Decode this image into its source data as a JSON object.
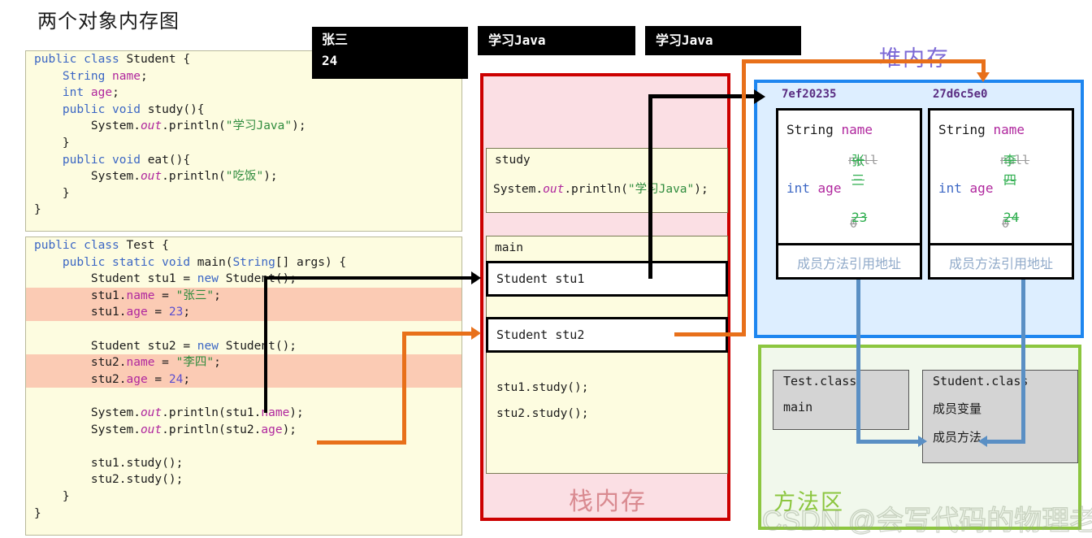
{
  "page": {
    "title": "两个对象内存图",
    "watermark": "CSDN @会写代码的物理老师"
  },
  "console_outputs": {
    "name_age": {
      "line1": "张三",
      "line2": "24"
    },
    "study1": "学习Java",
    "study2": "学习Java"
  },
  "code_student": {
    "lines": [
      "public class Student {",
      "    String name;",
      "    int age;",
      "    public void study(){",
      "        System.out.println(\"学习Java\");",
      "    }",
      "    public void eat(){",
      "        System.out.println(\"吃饭\");",
      "    }",
      "}"
    ]
  },
  "code_test": {
    "lines": [
      "public class Test {",
      "    public static void main(String[] args) {",
      "        Student stu1 = new Student();",
      "        stu1.name = \"张三\";",
      "        stu1.age = 23;",
      "",
      "        Student stu2 = new Student();",
      "        stu2.name = \"李四\";",
      "        stu2.age = 24;",
      "",
      "        System.out.println(stu1.name);",
      "        System.out.println(stu2.age);",
      "",
      "        stu1.study();",
      "        stu2.study();",
      "    }",
      "}"
    ]
  },
  "stack": {
    "label": "栈内存",
    "frames": [
      {
        "name": "study",
        "body": "System.out.println(\"学习Java\");"
      },
      {
        "name": "main",
        "body1": "stu1.study();",
        "body2": "stu2.study();"
      }
    ],
    "variables": [
      {
        "label": "Student stu1"
      },
      {
        "label": "Student stu2"
      }
    ]
  },
  "heap": {
    "label": "堆内存",
    "objects": [
      {
        "address": "7ef20235",
        "field_name_decl": "String name",
        "field_name_old": "null",
        "field_name_new": "张三",
        "field_age_decl": "int age",
        "field_age_old": "0",
        "field_age_new": "23",
        "method_ref": "成员方法引用地址"
      },
      {
        "address": "27d6c5e0",
        "field_name_decl": "String name",
        "field_name_old": "null",
        "field_name_new": "李四",
        "field_age_decl": "int age",
        "field_age_old": "0",
        "field_age_new": "24",
        "method_ref": "成员方法引用地址"
      }
    ]
  },
  "method_area": {
    "label": "方法区",
    "classes": [
      {
        "name": "Test.class",
        "entries": [
          "main"
        ]
      },
      {
        "name": "Student.class",
        "entries": [
          "成员变量",
          "成员方法"
        ]
      }
    ]
  },
  "colors": {
    "stack_border": "#cc0000",
    "stack_fill": "#fbdfe4",
    "heap_border": "#1e86f0",
    "heap_fill": "#ddeeff",
    "method_border": "#8cc63f",
    "method_fill": "#f1f8ec",
    "arrow_black": "#000000",
    "arrow_orange": "#e8701a",
    "arrow_blue": "#5a8fc4",
    "code_bg": "#fdfce0",
    "highlight": "#fbcbb4",
    "value_new": "#2eae4e",
    "value_old": "#9a9a9a"
  }
}
